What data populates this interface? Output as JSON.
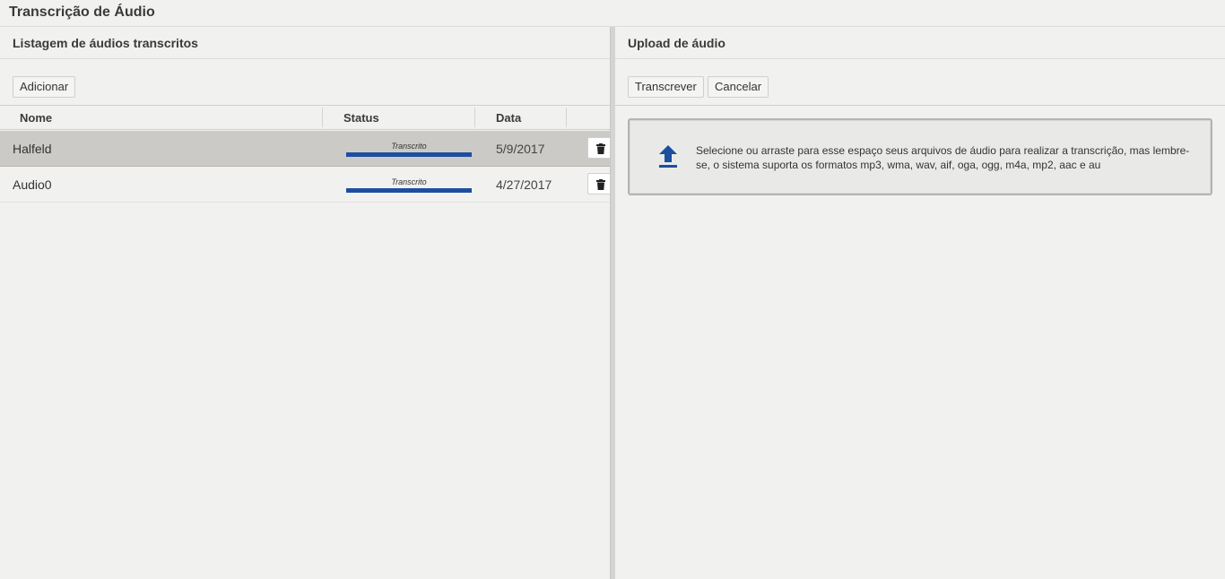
{
  "app": {
    "title": "Transcrição de Áudio"
  },
  "left": {
    "title": "Listagem de áudios transcritos",
    "add_label": "Adicionar",
    "columns": [
      "Nome",
      "Status",
      "Data"
    ],
    "rows": [
      {
        "name": "Halfeld",
        "status": "Transcrito",
        "progress": 1.0,
        "date": "5/9/2017",
        "selected": true
      },
      {
        "name": "Audio0",
        "status": "Transcrito",
        "progress": 1.0,
        "date": "4/27/2017",
        "selected": false
      }
    ]
  },
  "right": {
    "title": "Upload de áudio",
    "transcribe_label": "Transcrever",
    "cancel_label": "Cancelar",
    "dropzone_text": "Selecione ou arraste para esse espaço seus arquivos de áudio para realizar a transcrição, mas lembre-se, o sistema suporta os formatos mp3, wma, wav, aif, oga, ogg, m4a, mp2, aac e au"
  },
  "colors": {
    "accent": "#1c4fa0",
    "selected_row": "#cccac6"
  }
}
